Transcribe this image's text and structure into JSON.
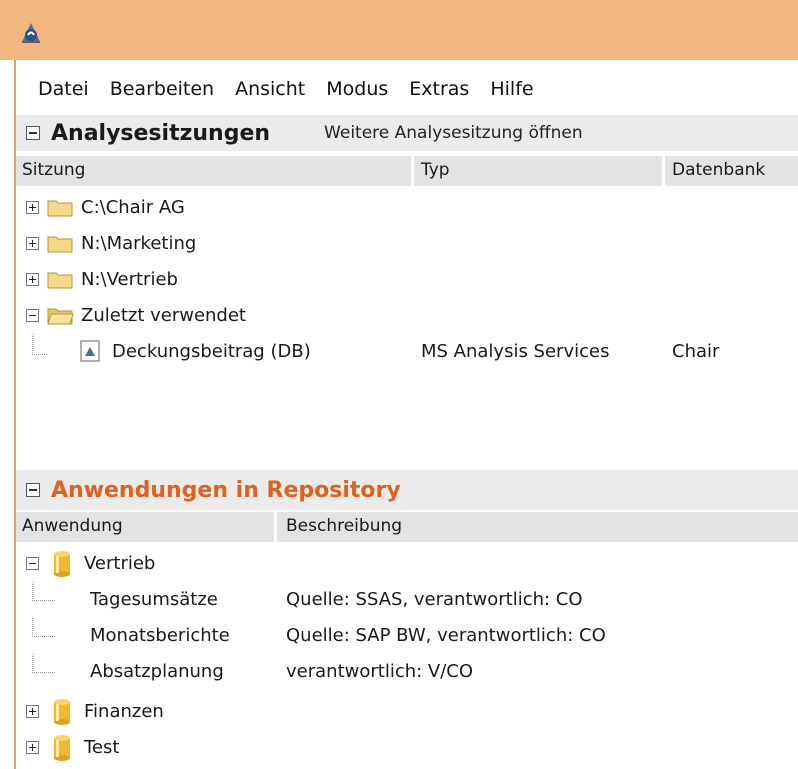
{
  "menu": [
    "Datei",
    "Bearbeiten",
    "Ansicht",
    "Modus",
    "Extras",
    "Hilfe"
  ],
  "sessions": {
    "title": "Analysesitzungen",
    "open_link": "Weitere Analysesitzung öffnen",
    "columns": [
      "Sitzung",
      "Typ",
      "Datenbank"
    ],
    "folders": [
      "C:\\Chair AG",
      "N:\\Marketing",
      "N:\\Vertrieb",
      "Zuletzt verwendet"
    ],
    "recent_item": {
      "name": "Deckungsbeitrag (DB)",
      "type": "MS Analysis Services",
      "database": "Chair"
    }
  },
  "repository": {
    "title": "Anwendungen in Repository",
    "title_color": "#e0601e",
    "columns": [
      "Anwendung",
      "Beschreibung"
    ],
    "groups": [
      "Vertrieb",
      "Finanzen",
      "Test"
    ],
    "apps": [
      {
        "name": "Tagesumsätze",
        "description": "Quelle: SSAS, verantwortlich: CO"
      },
      {
        "name": "Monatsberichte",
        "description": "Quelle: SAP BW, verantwortlich: CO"
      },
      {
        "name": "Absatzplanung",
        "description": "verantwortlich: V/CO"
      }
    ]
  },
  "icons": {
    "app": "app-logo-icon",
    "folder": "folder-icon",
    "open_folder": "folder-open-icon",
    "document": "analysis-document-icon",
    "database": "database-cylinder-icon"
  },
  "colors": {
    "titlebar": "#f0b87f",
    "header_bg": "#ebebeb",
    "folder": "#f5d98a",
    "cylinder": "#f2b830"
  }
}
